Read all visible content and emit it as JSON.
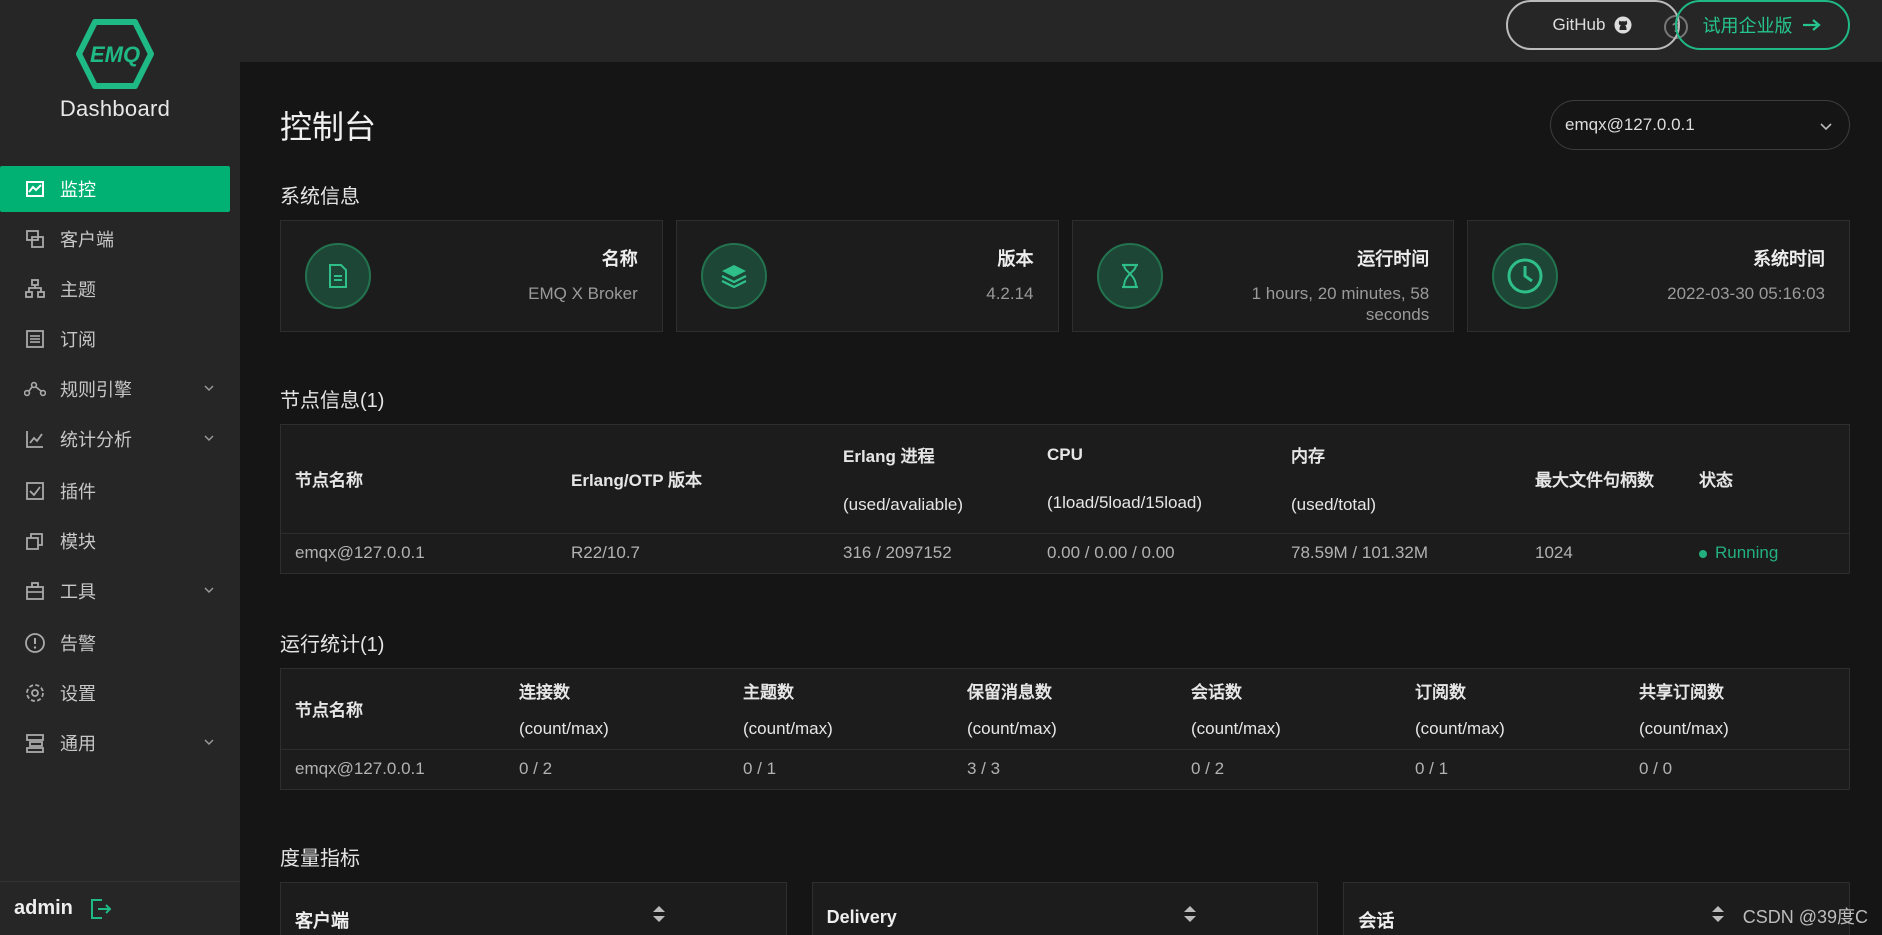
{
  "brand": {
    "logo_text": "EMQ",
    "name": "Dashboard"
  },
  "sidebar": {
    "items": [
      {
        "label": "监控",
        "icon": "monitor-icon",
        "active": true
      },
      {
        "label": "客户端",
        "icon": "clients-icon"
      },
      {
        "label": "主题",
        "icon": "topics-icon"
      },
      {
        "label": "订阅",
        "icon": "subscriptions-icon"
      },
      {
        "label": "规则引擎",
        "icon": "rules-icon",
        "expandable": true
      },
      {
        "label": "统计分析",
        "icon": "analytics-icon",
        "expandable": true
      },
      {
        "label": "插件",
        "icon": "plugins-icon"
      },
      {
        "label": "模块",
        "icon": "modules-icon"
      },
      {
        "label": "工具",
        "icon": "tools-icon",
        "expandable": true
      },
      {
        "label": "告警",
        "icon": "alarm-icon"
      },
      {
        "label": "设置",
        "icon": "settings-icon"
      },
      {
        "label": "通用",
        "icon": "general-icon",
        "expandable": true
      }
    ],
    "user": "admin"
  },
  "header": {
    "help": "?",
    "github_label": "GitHub",
    "trial_label": "试用企业版"
  },
  "main": {
    "title": "控制台",
    "node_select": "emqx@127.0.0.1",
    "system_info_title": "系统信息",
    "cards": [
      {
        "label": "名称",
        "value": "EMQ X Broker",
        "icon": "document-icon"
      },
      {
        "label": "版本",
        "value": "4.2.14",
        "icon": "layers-icon"
      },
      {
        "label": "运行时间",
        "value": "1 hours, 20 minutes, 58 seconds",
        "icon": "hourglass-icon"
      },
      {
        "label": "系统时间",
        "value": "2022-03-30 05:16:03",
        "icon": "clock-icon"
      }
    ],
    "nodes_title": "节点信息(1)",
    "nodes_headers": {
      "name": "节点名称",
      "otp": "Erlang/OTP 版本",
      "proc": "Erlang 进程",
      "proc_sub": "(used/avaliable)",
      "cpu": "CPU",
      "cpu_sub": "(1load/5load/15load)",
      "mem": "内存",
      "mem_sub": "(used/total)",
      "fd": "最大文件句柄数",
      "status": "状态"
    },
    "nodes_row": {
      "name": "emqx@127.0.0.1",
      "otp": "R22/10.7",
      "proc": "316 / 2097152",
      "cpu": "0.00 / 0.00 / 0.00",
      "mem": "78.59M / 101.32M",
      "fd": "1024",
      "status": "Running"
    },
    "stats_title": "运行统计(1)",
    "stats_headers": {
      "name": "节点名称",
      "sub": "(count/max)",
      "connections": "连接数",
      "topics": "主题数",
      "retained": "保留消息数",
      "sessions": "会话数",
      "subscriptions": "订阅数",
      "shared": "共享订阅数"
    },
    "stats_row": {
      "name": "emqx@127.0.0.1",
      "connections": "0 / 2",
      "topics": "0 / 1",
      "retained": "3 / 3",
      "sessions": "0 / 2",
      "subscriptions": "0 / 1",
      "shared": "0 / 0"
    },
    "metrics_title": "度量指标",
    "metrics": [
      "客户端",
      "Delivery",
      "会话"
    ]
  },
  "watermark": "CSDN @39度C",
  "colors": {
    "accent": "#00b173",
    "sidebar_bg": "#262626",
    "main_bg": "#151515"
  }
}
